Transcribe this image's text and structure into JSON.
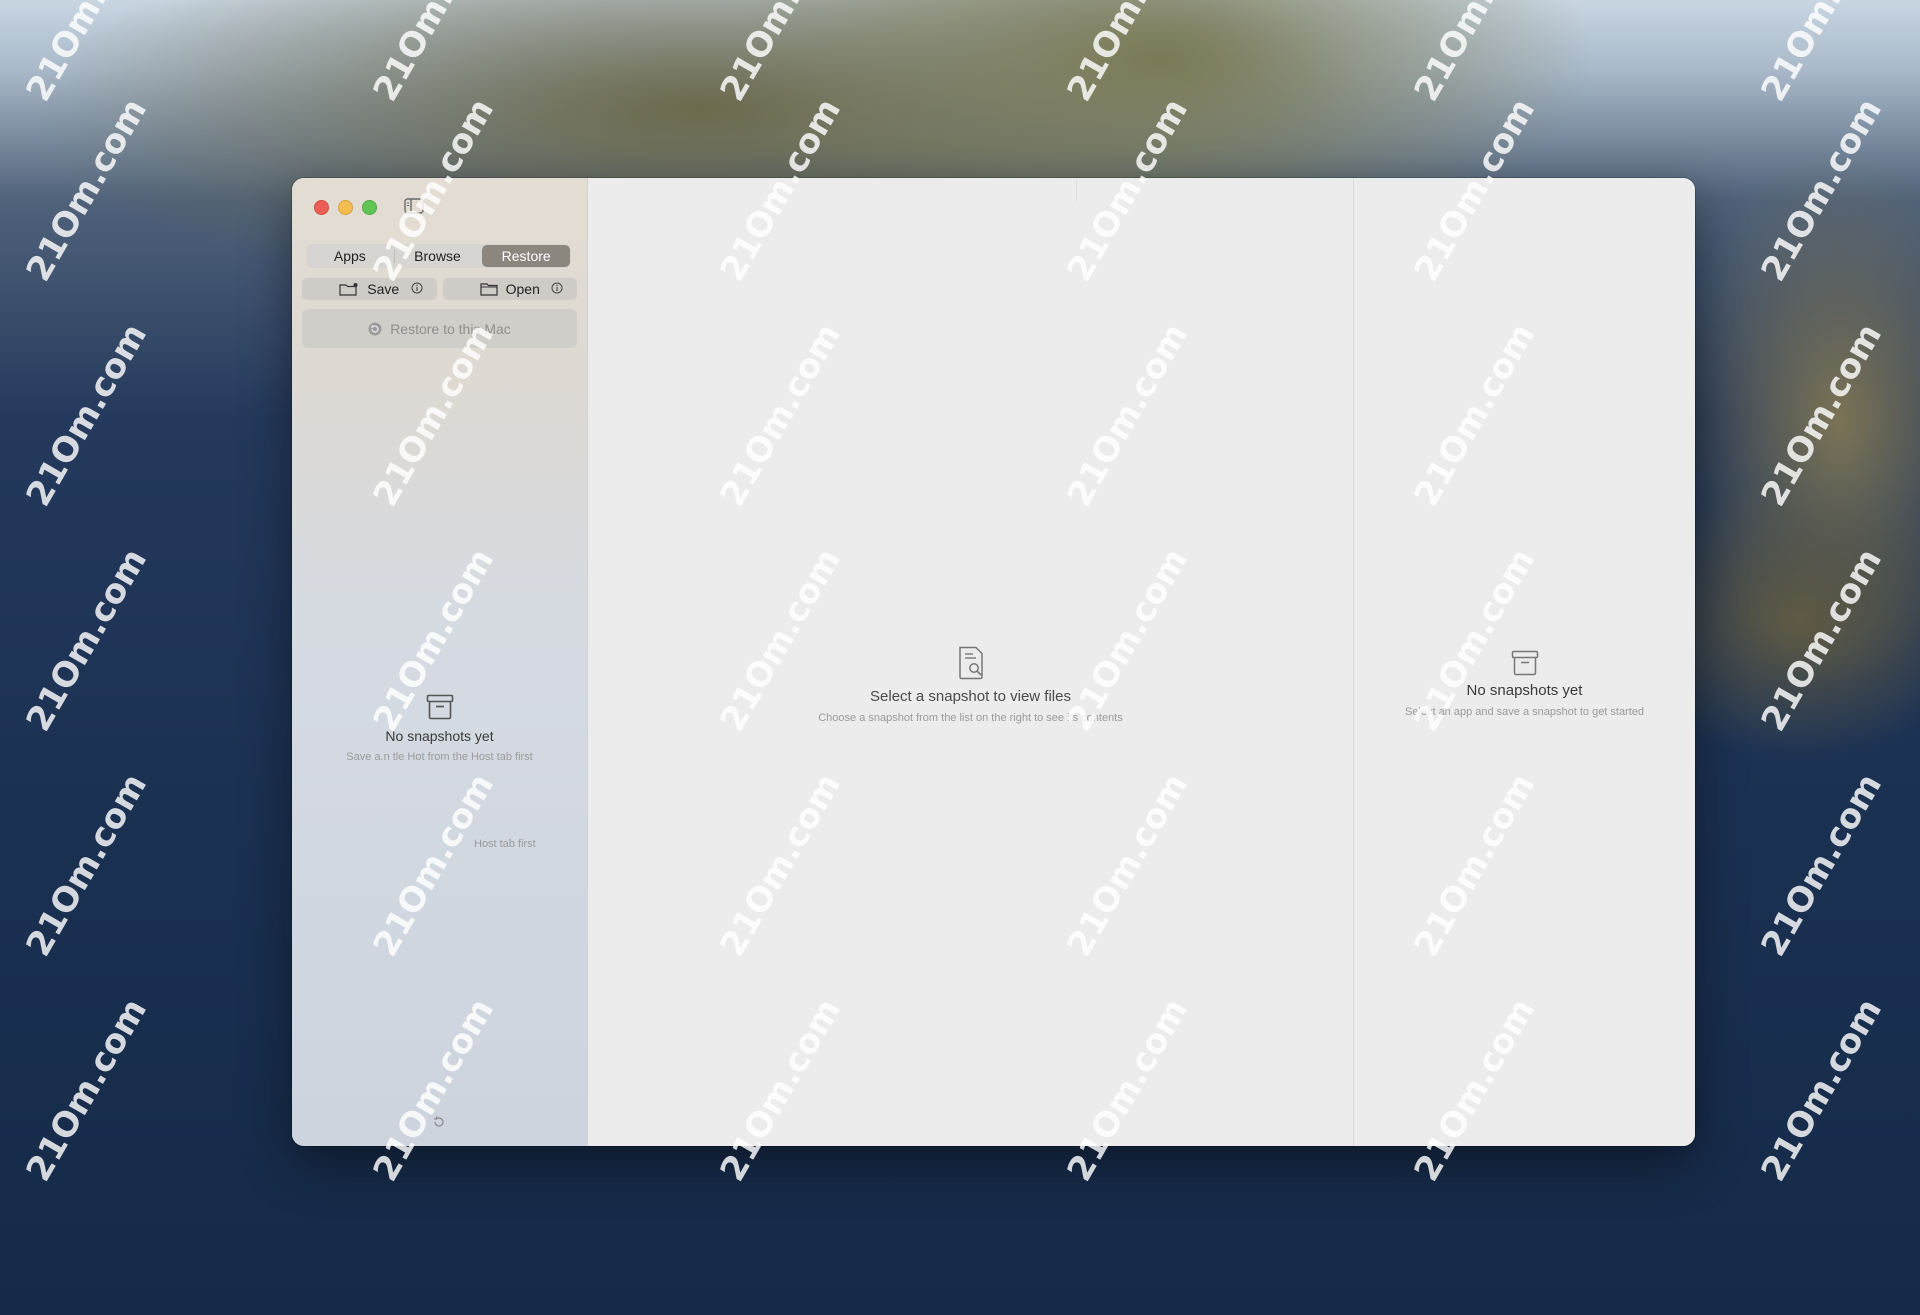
{
  "sidebar": {
    "tabs": [
      {
        "label": "Apps",
        "active": false
      },
      {
        "label": "Browse",
        "active": false
      },
      {
        "label": "Restore",
        "active": true
      }
    ],
    "save_label": "Save",
    "open_label": "Open",
    "restore_label": "Restore to this Mac",
    "empty_title": "No snapshots yet",
    "empty_subtitle": "Save a.n tle Hot from the Host tab first",
    "hint": "Host tab first"
  },
  "main": {
    "empty_title": "Select a snapshot to view files",
    "empty_subtitle": "Choose a snapshot from the list on the right to see its contents"
  },
  "detail": {
    "empty_title": "No snapshots yet",
    "empty_subtitle": "Select an app and save a snapshot to get started"
  },
  "watermark": "21Om.com",
  "colors": {
    "active_tab": "#8b867e",
    "close": "#ec5f56",
    "minimize": "#f4bd4f",
    "maximize": "#61c554"
  }
}
